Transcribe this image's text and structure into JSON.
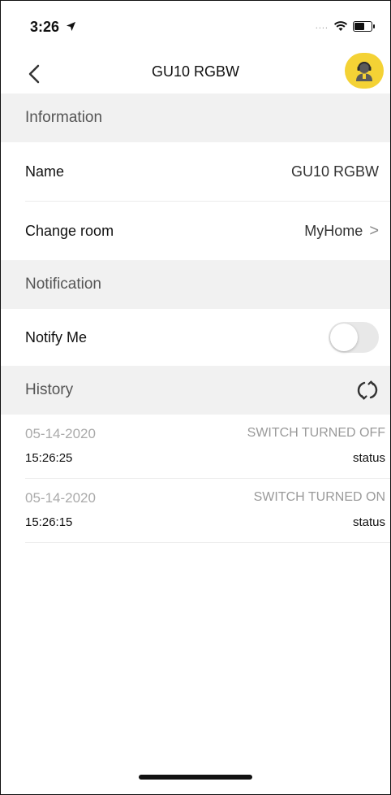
{
  "status_bar": {
    "time": "3:26",
    "signal": "....",
    "icons": [
      "location-arrow-icon",
      "wifi-icon",
      "battery-icon"
    ]
  },
  "nav": {
    "title": "GU10 RGBW",
    "back_icon": "chevron-left-icon",
    "support_icon": "support-agent-icon",
    "support_color": "#f4d235"
  },
  "sections": {
    "information": {
      "header": "Information",
      "name_label": "Name",
      "name_value": "GU10 RGBW",
      "room_label": "Change room",
      "room_value": "MyHome",
      "room_chevron": ">"
    },
    "notification": {
      "header": "Notification",
      "notify_label": "Notify Me",
      "notify_on": false
    },
    "history": {
      "header": "History",
      "refresh_icon": "refresh-icon",
      "entries": [
        {
          "date": "05-14-2020",
          "time": "15:26:25",
          "event": "SWITCH TURNED OFF",
          "status": "status"
        },
        {
          "date": "05-14-2020",
          "time": "15:26:15",
          "event": "SWITCH TURNED ON",
          "status": "status"
        }
      ]
    }
  }
}
